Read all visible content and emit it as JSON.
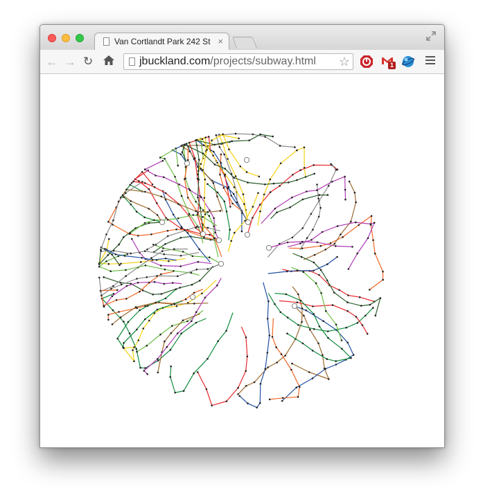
{
  "tab": {
    "title": "Van Cortlandt Park 242 St",
    "close_glyph": "×"
  },
  "address": {
    "host": "jbuckland.com",
    "path": "/projects/subway.html"
  },
  "extensions": {
    "gmail_badge": "1"
  },
  "icons": {
    "back": "back-arrow-icon",
    "forward": "forward-arrow-icon",
    "reload": "reload-icon",
    "home": "home-icon",
    "star": "bookmark-star-icon",
    "menu": "hamburger-menu-icon"
  },
  "map": {
    "line_colors": {
      "red": "#e8262a",
      "orange": "#f26522",
      "yellow": "#f5d10f",
      "green": "#0f8b3c",
      "lime": "#6cbe45",
      "blue": "#1f4fa3",
      "brown": "#9b6a2f",
      "gray": "#8c8c8c",
      "purple": "#b03ab5",
      "darkgreen": "#2a5c2a"
    }
  }
}
